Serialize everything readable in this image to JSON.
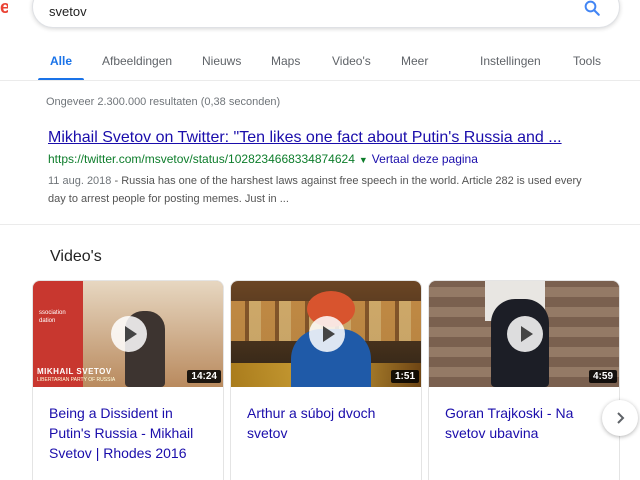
{
  "search": {
    "query": "svetov"
  },
  "tabs": [
    {
      "label": "Alle",
      "active": true
    },
    {
      "label": "Afbeeldingen"
    },
    {
      "label": "Nieuws"
    },
    {
      "label": "Maps"
    },
    {
      "label": "Video's"
    },
    {
      "label": "Meer"
    },
    {
      "label": "Instellingen"
    },
    {
      "label": "Tools"
    }
  ],
  "result_stats": "Ongeveer 2.300.000 resultaten (0,38 seconden)",
  "result": {
    "title": "Mikhail Svetov on Twitter: \"Ten likes one fact about Putin's Russia and ...",
    "url": "https://twitter.com/msvetov/status/1028234668334874624",
    "translate": "Vertaal deze pagina",
    "date": "11 aug. 2018",
    "snippet": " - Russia has one of the harshest laws against free speech in the world. Article 282 is used every day to arrest people for posting memes. Just in ..."
  },
  "videos": {
    "heading": "Video's",
    "items": [
      {
        "title": "Being a Dissident in Putin's Russia - Mikhail Svetov | Rhodes 2016",
        "duration": "14:24",
        "thumb_name": "MIKHAIL SVETOV",
        "thumb_sub": "LIBERTARIAN PARTY OF RUSSIA",
        "thumb_banner": "ssociation dation"
      },
      {
        "title": "Arthur a súboj dvoch svetov",
        "duration": "1:51"
      },
      {
        "title": "Goran Trajkoski - Na svetov ubavina",
        "duration": "4:59"
      }
    ]
  },
  "colors": {
    "link": "#1a0dab",
    "url_green": "#0d7d2b",
    "tab_active": "#1a73e8",
    "search_icon": "#4285f4"
  },
  "icons": {
    "search": "search-icon",
    "next": "chevron-right-icon",
    "url_menu": "caret-down-icon",
    "play": "play-icon"
  }
}
